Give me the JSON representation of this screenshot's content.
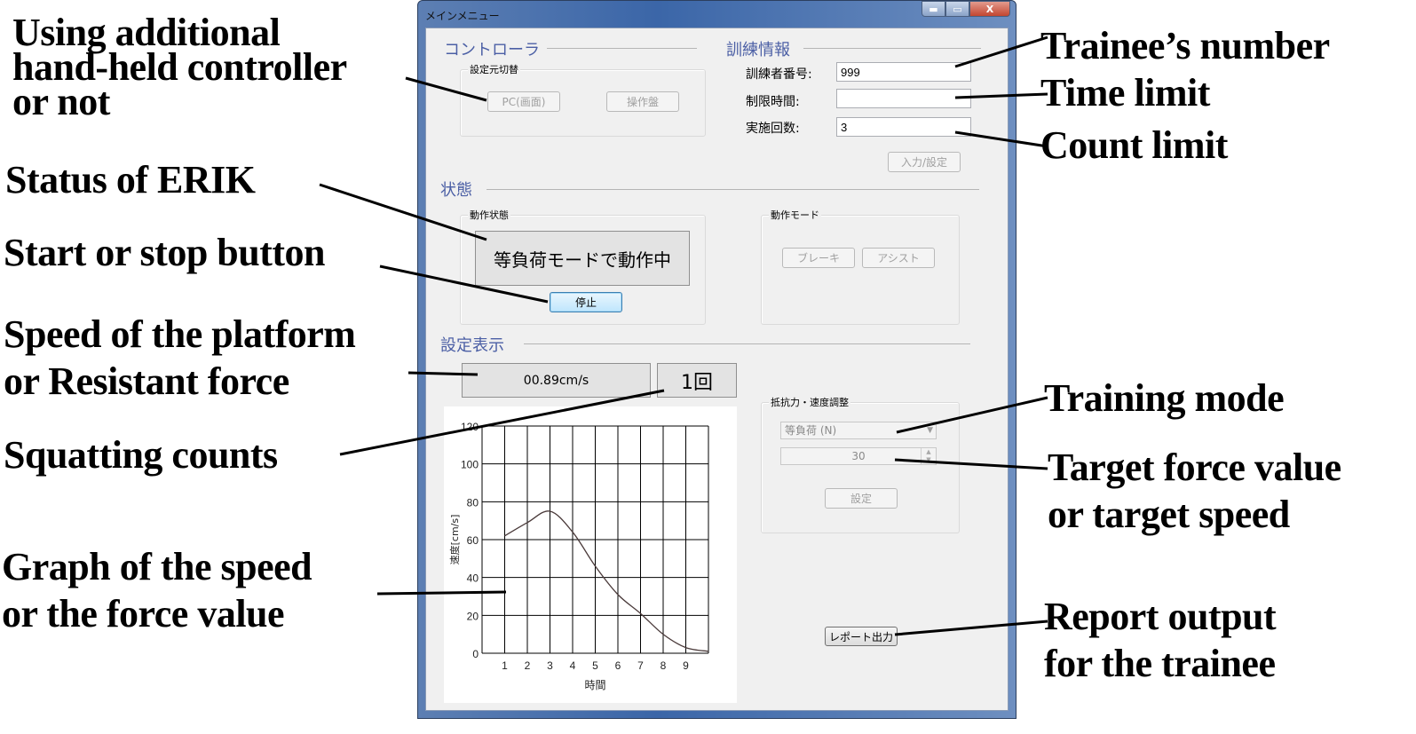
{
  "window": {
    "title": "メインメニュー",
    "minimize_icon": "minimize-icon",
    "maximize_icon": "maximize-icon",
    "close_icon": "close-icon",
    "close_glyph": "X",
    "minimize_glyph": "▬",
    "maximize_glyph": "▭"
  },
  "controller": {
    "section_title": "コントローラ",
    "group_label": "設定元切替",
    "pc_button": "PC(画面)",
    "panel_button": "操作盤"
  },
  "training_info": {
    "section_title": "訓練情報",
    "trainee_number_label": "訓練者番号:",
    "trainee_number_value": "999",
    "time_limit_label": "制限時間:",
    "time_limit_value": "",
    "count_label": "実施回数:",
    "count_value": "3",
    "submit_button": "入力/設定"
  },
  "status": {
    "section_title": "状態",
    "operation_group_label": "動作状態",
    "operation_status": "等負荷モードで動作中",
    "stop_button": "停止",
    "mode_group_label": "動作モード",
    "brake_button": "ブレーキ",
    "assist_button": "アシスト"
  },
  "settings_display": {
    "section_title": "設定表示",
    "speed_readout": "00.89cm/s",
    "count_readout": "1回"
  },
  "adjust": {
    "group_label": "抵抗力・速度調整",
    "mode_select_value": "等負荷 (N)",
    "target_value": "30",
    "set_button": "設定",
    "report_button": "レポート出力"
  },
  "chart_data": {
    "type": "line",
    "title": "",
    "xlabel": "時間",
    "ylabel": "速度[cm/s]",
    "x_ticks": [
      "1",
      "2",
      "3",
      "4",
      "5",
      "6",
      "7",
      "8",
      "9"
    ],
    "y_ticks": [
      "0",
      "20",
      "40",
      "60",
      "80",
      "100",
      "120"
    ],
    "xlim": [
      0,
      10
    ],
    "ylim": [
      0,
      120
    ],
    "grid": true,
    "series": [
      {
        "name": "speed",
        "color": "#4a3a3a",
        "x": [
          1,
          2,
          3,
          4,
          5,
          6,
          7,
          8,
          9,
          10
        ],
        "y": [
          62,
          69,
          75,
          64,
          46,
          31,
          21,
          10,
          3,
          1
        ]
      }
    ]
  },
  "annotations": {
    "controller": [
      "Using additional",
      "hand-held controller",
      "or not"
    ],
    "status": "Status of ERIK",
    "start_stop": "Start or stop button",
    "speed": [
      "Speed of the platform",
      "or Resistant force"
    ],
    "squat_counts": "Squatting counts",
    "graph": [
      "Graph of the speed",
      "or the force value"
    ],
    "trainee_number": "Trainee’s number",
    "time_limit": "Time limit",
    "count_limit": "Count limit",
    "training_mode": "Training mode",
    "target": [
      "Target force value",
      "or target speed"
    ],
    "report": [
      "Report output",
      "for the trainee"
    ]
  }
}
